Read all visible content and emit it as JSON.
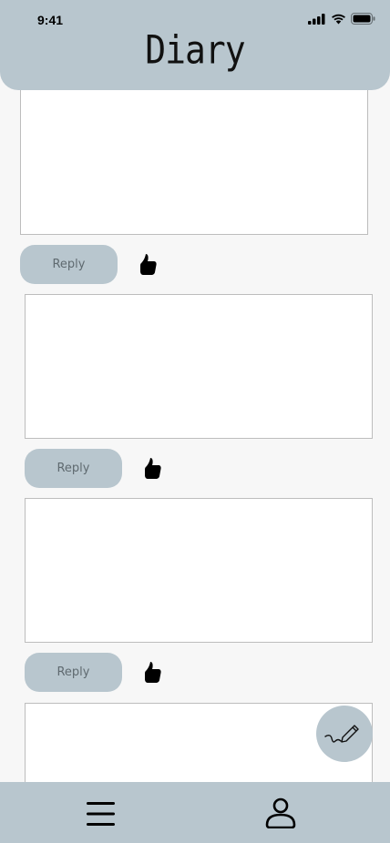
{
  "status_bar": {
    "time": "9:41",
    "icons": [
      "signal-icon",
      "wifi-icon",
      "battery-icon"
    ]
  },
  "header": {
    "title": "Diary"
  },
  "entries": [
    {
      "reply_label": "Reply",
      "like_icon": "thumbs-up-icon"
    },
    {
      "reply_label": "Reply",
      "like_icon": "thumbs-up-icon"
    },
    {
      "reply_label": "Reply",
      "like_icon": "thumbs-up-icon"
    },
    {
      "reply_label": "",
      "like_icon": ""
    }
  ],
  "fab": {
    "icon": "pen-signature-icon"
  },
  "bottom_nav": {
    "items": [
      {
        "icon": "menu-icon"
      },
      {
        "icon": "profile-icon"
      }
    ]
  },
  "colors": {
    "accent": "#b8c6ce",
    "background": "#f7f7f7",
    "card": "#ffffff",
    "card_border": "#bdbdbd"
  }
}
